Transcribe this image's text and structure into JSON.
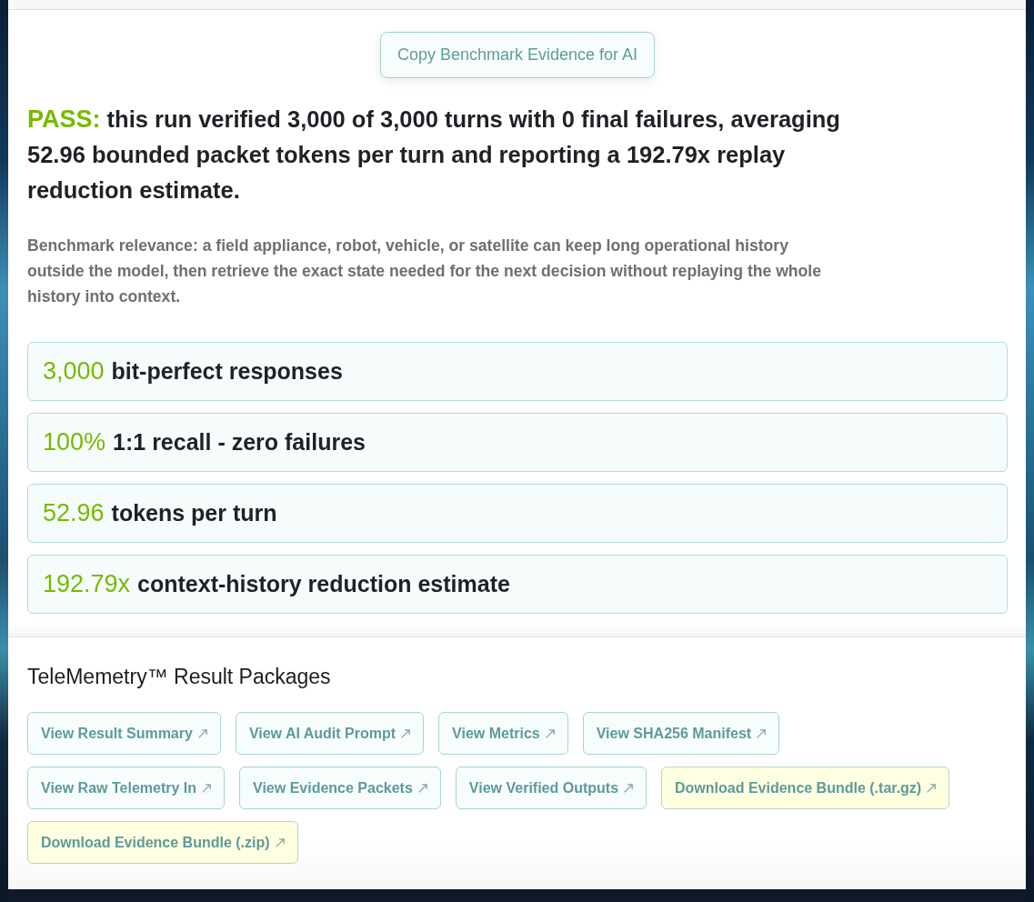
{
  "copy_button": {
    "label": "Copy Benchmark Evidence for AI"
  },
  "summary": {
    "verdict": "PASS:",
    "text": "this run verified 3,000 of 3,000 turns with 0 final failures, averaging 52.96 bounded packet tokens per turn and reporting a 192.79x replay reduction estimate."
  },
  "relevance": "Benchmark relevance: a field appliance, robot, vehicle, or satellite can keep long operational history outside the model, then retrieve the exact state needed for the next decision without replaying the whole history into context.",
  "metrics": [
    {
      "value": "3,000",
      "label": "bit-perfect responses"
    },
    {
      "value": "100%",
      "label": "1:1 recall - zero failures"
    },
    {
      "value": "52.96",
      "label": "tokens per turn"
    },
    {
      "value": "192.79x",
      "label": "context-history reduction estimate"
    }
  ],
  "packages": {
    "title": "TeleMemetry™ Result Packages",
    "links": [
      {
        "label": "View Result Summary",
        "kind": "view"
      },
      {
        "label": "View AI Audit Prompt",
        "kind": "view"
      },
      {
        "label": "View Metrics",
        "kind": "view"
      },
      {
        "label": "View SHA256 Manifest",
        "kind": "view"
      },
      {
        "label": "View Raw Telemetry In",
        "kind": "view"
      },
      {
        "label": "View Evidence Packets",
        "kind": "view"
      },
      {
        "label": "View Verified Outputs",
        "kind": "view"
      },
      {
        "label": "Download Evidence Bundle (.tar.gz)",
        "kind": "download"
      },
      {
        "label": "Download Evidence Bundle (.zip)",
        "kind": "download"
      }
    ]
  }
}
